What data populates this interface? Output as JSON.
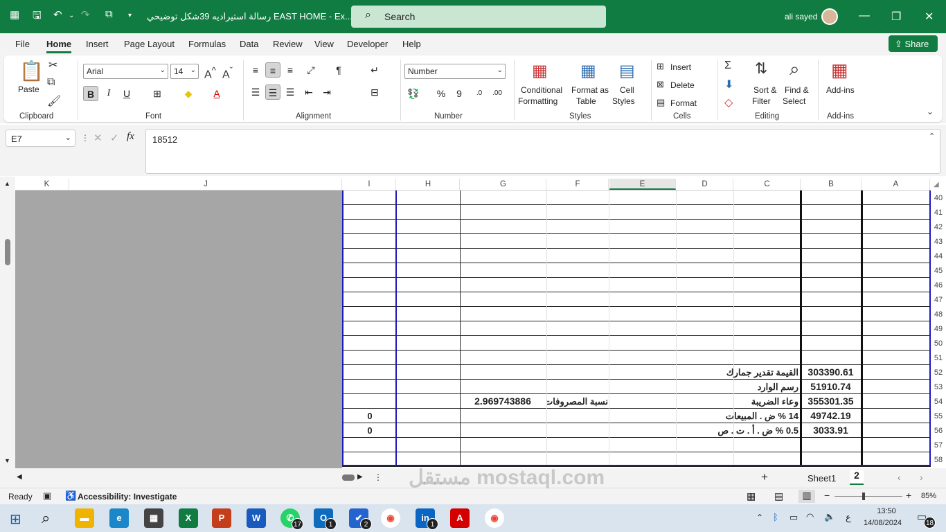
{
  "titlebar": {
    "title": "رسالة استيراديه 39شكل توضيحي EAST HOME  -  Ex...",
    "search_placeholder": "Search",
    "user": "ali sayed"
  },
  "menu": [
    "File",
    "Home",
    "Insert",
    "Page Layout",
    "Formulas",
    "Data",
    "Review",
    "View",
    "Developer",
    "Help"
  ],
  "share_label": "Share",
  "ribbon": {
    "clipboard": {
      "paste": "Paste",
      "group": "Clipboard"
    },
    "font": {
      "name": "Arial",
      "size": "14",
      "group": "Font"
    },
    "alignment": {
      "group": "Alignment"
    },
    "number": {
      "format": "Number",
      "group": "Number"
    },
    "styles": {
      "conditional": "Conditional",
      "formatting": "Formatting",
      "format_as": "Format as",
      "table": "Table",
      "cell": "Cell",
      "cell_styles": "Styles",
      "group": "Styles"
    },
    "cells": {
      "insert": "Insert",
      "delete": "Delete",
      "format": "Format",
      "group": "Cells"
    },
    "editing": {
      "sort": "Sort &",
      "filter": "Filter",
      "find": "Find &",
      "select": "Select",
      "group": "Editing"
    },
    "addins": {
      "label": "Add-ins",
      "group": "Add-ins"
    }
  },
  "formula": {
    "namebox": "E7",
    "value": "18512"
  },
  "columns": [
    "K",
    "J",
    "I",
    "H",
    "G",
    "F",
    "E",
    "D",
    "C",
    "B",
    "A"
  ],
  "rows": [
    "40",
    "41",
    "42",
    "43",
    "44",
    "45",
    "46",
    "47",
    "48",
    "49",
    "50",
    "51",
    "52",
    "53",
    "54",
    "55",
    "56",
    "57",
    "58"
  ],
  "cells": {
    "b52": "303390.61",
    "c52": "القيمة تقدير جمارك",
    "b53": "51910.74",
    "c53": "رسم الوارد",
    "b54": "355301.35",
    "c54": "وعاء الضريبة",
    "g54": "2.969743886",
    "f54": "نسبة المصروفات",
    "b55": "49742.19",
    "c55": "14 % ض . المبيعات",
    "i55": "0",
    "b56": "3033.91",
    "c56": "0.5 % ض . أ . ت . ص",
    "i56": "0"
  },
  "sheet_tabs": {
    "sheet1": "Sheet1",
    "sheet2": "2"
  },
  "status": {
    "ready": "Ready",
    "accessibility": "Accessibility: Investigate",
    "zoom": "85%"
  },
  "taskbar": {
    "time": "13:50",
    "date": "14/08/2024",
    "lang": "ع",
    "notif": "18",
    "whatsapp": "17",
    "outlook": "1",
    "todo": "2",
    "linkedin": "1"
  },
  "watermark": "مستقل mostaql.com"
}
